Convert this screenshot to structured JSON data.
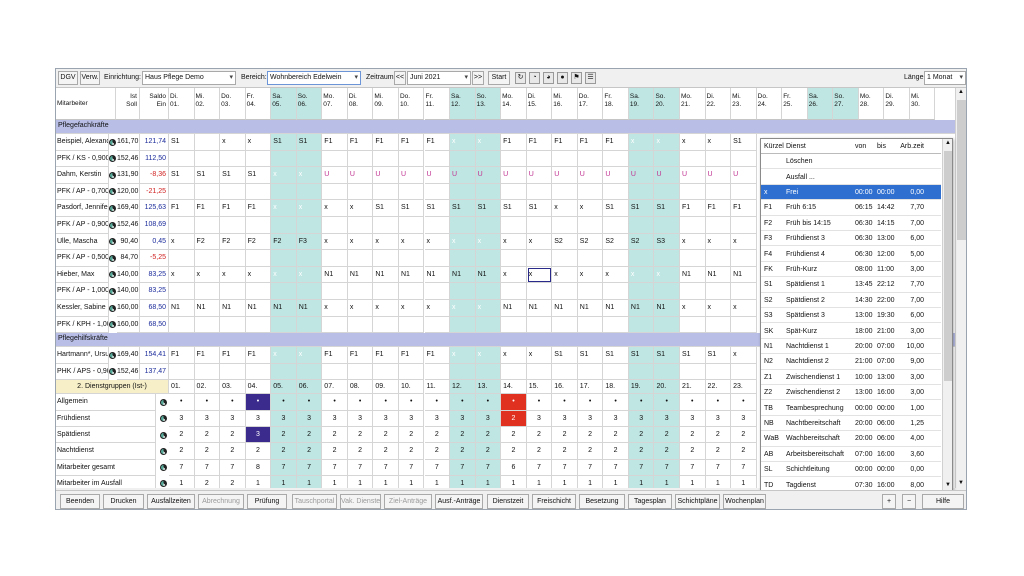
{
  "toolbar": {
    "dgv": "DGV",
    "verw": "Verw.",
    "einrichtung_label": "Einrichtung:",
    "einrichtung": "Haus Pflege Demo",
    "bereich_label": "Bereich:",
    "bereich": "Wohnbereich Edelwein",
    "zeitraum_label": "Zeitraum:",
    "prev": "<<",
    "month": "Juni 2021",
    "next": ">>",
    "start": "Start",
    "laenge_label": "Länge:",
    "laenge": "1 Monat"
  },
  "header": {
    "mitarbeiter": "Mitarbeiter",
    "ist": "Ist",
    "soll": "Soll",
    "saldo": "Saldo",
    "ein": "Ein",
    "days": [
      [
        "Di.",
        "01."
      ],
      [
        "Mi.",
        "02."
      ],
      [
        "Do.",
        "03."
      ],
      [
        "Fr.",
        "04."
      ],
      [
        "Sa.",
        "05."
      ],
      [
        "So.",
        "06."
      ],
      [
        "Mo.",
        "07."
      ],
      [
        "Di.",
        "08."
      ],
      [
        "Mi.",
        "09."
      ],
      [
        "Do.",
        "10."
      ],
      [
        "Fr.",
        "11."
      ],
      [
        "Sa.",
        "12."
      ],
      [
        "So.",
        "13."
      ],
      [
        "Mo.",
        "14."
      ],
      [
        "Di.",
        "15."
      ],
      [
        "Mi.",
        "16."
      ],
      [
        "Do.",
        "17."
      ],
      [
        "Fr.",
        "18."
      ],
      [
        "Sa.",
        "19."
      ],
      [
        "So.",
        "20."
      ],
      [
        "Mo.",
        "21."
      ],
      [
        "Di.",
        "22."
      ],
      [
        "Mi.",
        "23."
      ],
      [
        "Do.",
        "24."
      ],
      [
        "Fr.",
        "25."
      ],
      [
        "Sa.",
        "26."
      ],
      [
        "So.",
        "27."
      ],
      [
        "Mo.",
        "28."
      ],
      [
        "Di.",
        "29."
      ],
      [
        "Mi.",
        "30."
      ]
    ]
  },
  "groups": [
    "Pflegefachkräfte",
    "Pflegehilfskräfte"
  ],
  "employees": [
    {
      "name": "Beispiel, Alexandra",
      "ist": "161,70",
      "saldo": "121,74",
      "sub": "PFK / KS - 0,900",
      "soll": "152,46",
      "ein": "112,50",
      "shifts": [
        "S1",
        "",
        "x",
        "x",
        "S1",
        "S1",
        "F1",
        "F1",
        "F1",
        "F1",
        "F1",
        "x",
        "x",
        "F1",
        "F1",
        "F1",
        "F1",
        "F1",
        "x",
        "x",
        "x",
        "x",
        "S1"
      ]
    },
    {
      "name": "Dahm, Kerstin",
      "ist": "131,90",
      "saldo": "-8,36",
      "sub": "PFK / AP - 0,700",
      "soll": "120,00",
      "ein": "-21,25",
      "shifts": [
        "S1",
        "S1",
        "S1",
        "S1",
        "x",
        "x",
        "U",
        "U",
        "U",
        "U",
        "U",
        "U",
        "U",
        "U",
        "U",
        "U",
        "U",
        "U",
        "U",
        "U",
        "U",
        "U",
        "U"
      ]
    },
    {
      "name": "Pasdorf, Jennifer",
      "ist": "169,40",
      "saldo": "125,63",
      "sub": "PFK / AP - 0,900",
      "soll": "152,46",
      "ein": "108,69",
      "shifts": [
        "F1",
        "F1",
        "F1",
        "F1",
        "x",
        "x",
        "x",
        "x",
        "S1",
        "S1",
        "S1",
        "S1",
        "S1",
        "S1",
        "S1",
        "x",
        "x",
        "S1",
        "S1",
        "S1",
        "F1",
        "F1",
        "F1"
      ]
    },
    {
      "name": "Ulle, Mascha",
      "ist": "90,40",
      "saldo": "0,45",
      "sub": "PFK / AP - 0,500",
      "soll": "84,70",
      "ein": "-5,25",
      "shifts": [
        "x",
        "F2",
        "F2",
        "F2",
        "F2",
        "F3",
        "x",
        "x",
        "x",
        "x",
        "x",
        "x",
        "x",
        "x",
        "x",
        "S2",
        "S2",
        "S2",
        "S2",
        "S3",
        "x",
        "x",
        "x"
      ]
    },
    {
      "name": "Hieber, Max",
      "ist": "140,00",
      "saldo": "83,25",
      "sub": "PFK / AP - 1,000",
      "soll": "140,00",
      "ein": "83,25",
      "shifts": [
        "x",
        "x",
        "x",
        "x",
        "x",
        "x",
        "N1",
        "N1",
        "N1",
        "N1",
        "N1",
        "N1",
        "N1",
        "x",
        "x",
        "x",
        "x",
        "x",
        "x",
        "x",
        "N1",
        "N1",
        "N1"
      ]
    },
    {
      "name": "Kessler, Sabine",
      "ist": "160,00",
      "saldo": "68,50",
      "sub": "PFK / KPH - 1,000",
      "soll": "160,00",
      "ein": "68,50",
      "shifts": [
        "N1",
        "N1",
        "N1",
        "N1",
        "N1",
        "N1",
        "x",
        "x",
        "x",
        "x",
        "x",
        "x",
        "x",
        "N1",
        "N1",
        "N1",
        "N1",
        "N1",
        "N1",
        "N1",
        "x",
        "x",
        "x"
      ]
    },
    {
      "name": "Hartmann*, Ursula",
      "ist": "169,40",
      "saldo": "154,41",
      "sub": "PHK / APS - 0,900",
      "soll": "152,46",
      "ein": "137,47",
      "shifts": [
        "F1",
        "F1",
        "F1",
        "F1",
        "x",
        "x",
        "F1",
        "F1",
        "F1",
        "F1",
        "F1",
        "x",
        "x",
        "x",
        "x",
        "S1",
        "S1",
        "S1",
        "S1",
        "S1",
        "S1",
        "S1",
        "x"
      ]
    }
  ],
  "dienstgruppen": {
    "label": "2. Dienstgruppen (Ist-)",
    "days": [
      "01.",
      "02.",
      "03.",
      "04.",
      "05.",
      "06.",
      "07.",
      "08.",
      "09.",
      "10.",
      "11.",
      "12.",
      "13.",
      "14.",
      "15.",
      "16.",
      "17.",
      "18.",
      "19.",
      "20.",
      "21.",
      "22.",
      "23."
    ],
    "rows": [
      {
        "name": "Allgemein",
        "values": [
          "•",
          "•",
          "•",
          "•",
          "•",
          "•",
          "•",
          "•",
          "•",
          "•",
          "•",
          "•",
          "•",
          "•",
          "•",
          "•",
          "•",
          "•",
          "•",
          "•",
          "•",
          "•",
          "•"
        ]
      },
      {
        "name": "Frühdienst",
        "values": [
          "3",
          "3",
          "3",
          "3",
          "3",
          "3",
          "3",
          "3",
          "3",
          "3",
          "3",
          "3",
          "3",
          "2",
          "3",
          "3",
          "3",
          "3",
          "3",
          "3",
          "3",
          "3",
          "3"
        ]
      },
      {
        "name": "Spätdienst",
        "values": [
          "2",
          "2",
          "2",
          "3",
          "2",
          "2",
          "2",
          "2",
          "2",
          "2",
          "2",
          "2",
          "2",
          "2",
          "2",
          "2",
          "2",
          "2",
          "2",
          "2",
          "2",
          "2",
          "2"
        ]
      },
      {
        "name": "Nachtdienst",
        "values": [
          "2",
          "2",
          "2",
          "2",
          "2",
          "2",
          "2",
          "2",
          "2",
          "2",
          "2",
          "2",
          "2",
          "2",
          "2",
          "2",
          "2",
          "2",
          "2",
          "2",
          "2",
          "2",
          "2"
        ]
      },
      {
        "name": "Mitarbeiter gesamt",
        "values": [
          "7",
          "7",
          "7",
          "8",
          "7",
          "7",
          "7",
          "7",
          "7",
          "7",
          "7",
          "7",
          "7",
          "6",
          "7",
          "7",
          "7",
          "7",
          "7",
          "7",
          "7",
          "7",
          "7"
        ]
      },
      {
        "name": "Mitarbeiter im Ausfall",
        "values": [
          "1",
          "2",
          "2",
          "1",
          "1",
          "1",
          "1",
          "1",
          "1",
          "1",
          "1",
          "1",
          "1",
          "1",
          "1",
          "1",
          "1",
          "1",
          "1",
          "1",
          "1",
          "1",
          "1"
        ]
      }
    ]
  },
  "popup": {
    "headers": [
      "Kürzel",
      "Dienst",
      "von",
      "bis",
      "Arb.zeit"
    ],
    "rows": [
      [
        "",
        "Löschen",
        "",
        "",
        ""
      ],
      [
        "",
        "Ausfall ...",
        "",
        "",
        ""
      ],
      [
        "x",
        "Frei",
        "00:00",
        "00:00",
        "0,00"
      ],
      [
        "F1",
        "Früh 6:15",
        "06:15",
        "14:42",
        "7,70"
      ],
      [
        "F2",
        "Früh bis 14:15",
        "06:30",
        "14:15",
        "7,00"
      ],
      [
        "F3",
        "Frühdienst 3",
        "06:30",
        "13:00",
        "6,00"
      ],
      [
        "F4",
        "Frühdienst 4",
        "06:30",
        "12:00",
        "5,00"
      ],
      [
        "FK",
        "Früh-Kurz",
        "08:00",
        "11:00",
        "3,00"
      ],
      [
        "S1",
        "Spätdienst 1",
        "13:45",
        "22:12",
        "7,70"
      ],
      [
        "S2",
        "Spätdienst 2",
        "14:30",
        "22:00",
        "7,00"
      ],
      [
        "S3",
        "Spätdienst 3",
        "13:00",
        "19:30",
        "6,00"
      ],
      [
        "SK",
        "Spät-Kurz",
        "18:00",
        "21:00",
        "3,00"
      ],
      [
        "N1",
        "Nachtdienst 1",
        "20:00",
        "07:00",
        "10,00"
      ],
      [
        "N2",
        "Nachtdienst 2",
        "21:00",
        "07:00",
        "9,00"
      ],
      [
        "Z1",
        "Zwischendienst 1",
        "10:00",
        "13:00",
        "3,00"
      ],
      [
        "Z2",
        "Zwischendienst 2",
        "13:00",
        "16:00",
        "3,00"
      ],
      [
        "TB",
        "Teambesprechung",
        "00:00",
        "00:00",
        "1,00"
      ],
      [
        "NB",
        "Nachtbereitschaft",
        "20:00",
        "06:00",
        "1,25"
      ],
      [
        "WaB",
        "Wachbereitschaft",
        "20:00",
        "06:00",
        "4,00"
      ],
      [
        "AB",
        "Arbeitsbereitschaft",
        "07:00",
        "16:00",
        "3,60"
      ],
      [
        "SL",
        "Schichtleitung",
        "00:00",
        "00:00",
        "0,00"
      ],
      [
        "TD",
        "Tagdienst",
        "07:30",
        "16:00",
        "8,00"
      ]
    ],
    "right_col": [
      "•",
      "3",
      "2",
      "2",
      "7",
      "1"
    ]
  },
  "bottom": [
    "Beenden",
    "Drucken",
    "Ausfallzeiten",
    "Abrechnung",
    "Prüfung",
    "Tauschportal",
    "Vak. Dienste",
    "Ziel-Anträge",
    "Ausf.-Anträge",
    "Dienstzeit",
    "Freischicht",
    "Besetzung",
    "Tagesplan",
    "Schichtpläne",
    "Wochenplan"
  ],
  "bottom_disabled": [
    3,
    5,
    6,
    7
  ],
  "bottom_right": {
    "plus": "+",
    "minus": "−",
    "hilfe": "Hilfe"
  },
  "colors": {
    "group": "#b8bee6",
    "weekend": "#bfe6e3",
    "selected": "#3a2b8c",
    "alert": "#e03020",
    "popup_sel": "#2f6fd0",
    "neg": "#d02020",
    "blue_num": "#1a2a9a"
  }
}
